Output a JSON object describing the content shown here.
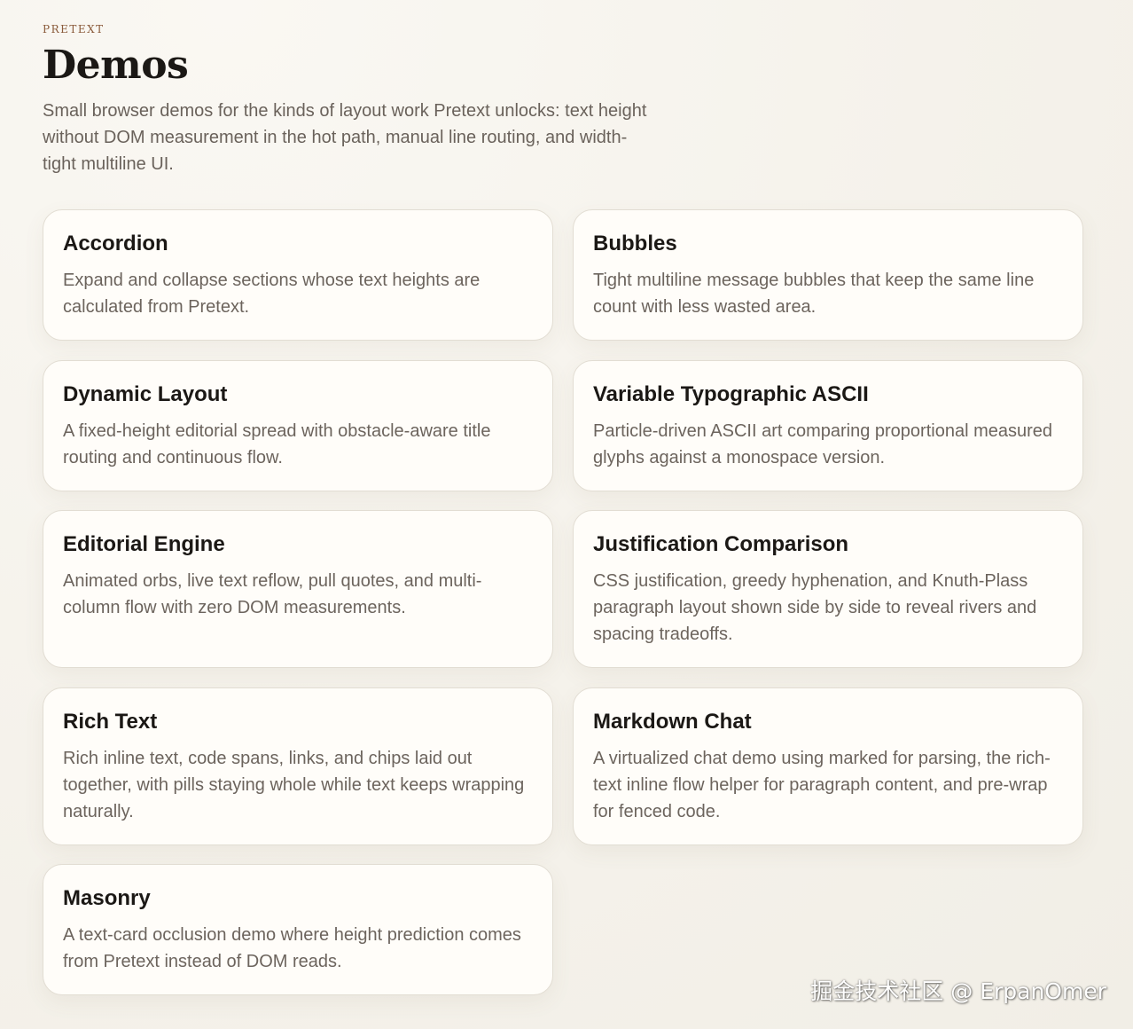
{
  "header": {
    "eyebrow": "PRETEXT",
    "title": "Demos",
    "intro": "Small browser demos for the kinds of layout work Pretext unlocks: text height without DOM measurement in the hot path, manual line routing, and width-tight multiline UI."
  },
  "cards": [
    {
      "title": "Accordion",
      "description": "Expand and collapse sections whose text heights are calculated from Pretext."
    },
    {
      "title": "Bubbles",
      "description": "Tight multiline message bubbles that keep the same line count with less wasted area."
    },
    {
      "title": "Dynamic Layout",
      "description": "A fixed-height editorial spread with obstacle-aware title routing and continuous flow."
    },
    {
      "title": "Variable Typographic ASCII",
      "description": "Particle-driven ASCII art comparing proportional measured glyphs against a monospace version."
    },
    {
      "title": "Editorial Engine",
      "description": "Animated orbs, live text reflow, pull quotes, and multi-column flow with zero DOM measurements."
    },
    {
      "title": "Justification Comparison",
      "description": "CSS justification, greedy hyphenation, and Knuth-Plass paragraph layout shown side by side to reveal rivers and spacing tradeoffs."
    },
    {
      "title": "Rich Text",
      "description": "Rich inline text, code spans, links, and chips laid out together, with pills staying whole while text keeps wrapping naturally."
    },
    {
      "title": "Markdown Chat",
      "description": "A virtualized chat demo using marked for parsing, the rich-text inline flow helper for paragraph content, and pre-wrap for fenced code."
    },
    {
      "title": "Masonry",
      "description": "A text-card occlusion demo where height prediction comes from Pretext instead of DOM reads."
    }
  ],
  "watermark": "掘金技术社区 @ ErpanOmer"
}
